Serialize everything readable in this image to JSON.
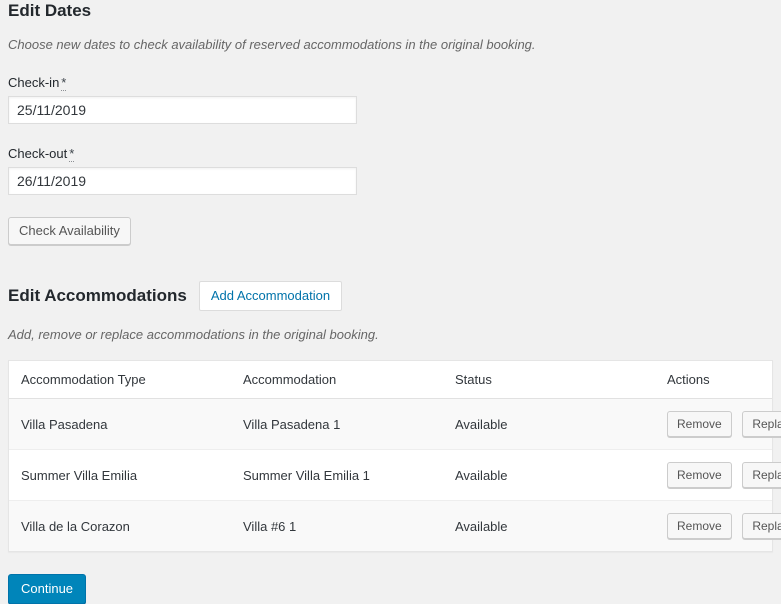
{
  "dates_section": {
    "title": "Edit Dates",
    "description": "Choose new dates to check availability of reserved accommodations in the original booking.",
    "checkin": {
      "label": "Check-in",
      "required_mark": "*",
      "value": "25/11/2019",
      "placeholder": ""
    },
    "checkout": {
      "label": "Check-out",
      "required_mark": "*",
      "value": "26/11/2019",
      "placeholder": ""
    },
    "check_availability_label": "Check Availability"
  },
  "accommodations_section": {
    "title": "Edit Accommodations",
    "add_button_label": "Add Accommodation",
    "description": "Add, remove or replace accommodations in the original booking.",
    "table": {
      "columns": [
        "Accommodation Type",
        "Accommodation",
        "Status",
        "Actions"
      ],
      "rows": [
        {
          "type": "Villa Pasadena",
          "accommodation": "Villa Pasadena 1",
          "status": "Available",
          "remove_label": "Remove",
          "replace_label": "Replace"
        },
        {
          "type": "Summer Villa Emilia",
          "accommodation": "Summer Villa Emilia 1",
          "status": "Available",
          "remove_label": "Remove",
          "replace_label": "Replace"
        },
        {
          "type": "Villa de la Corazon",
          "accommodation": "Villa #6 1",
          "status": "Available",
          "remove_label": "Remove",
          "replace_label": "Replace"
        }
      ]
    }
  },
  "footer": {
    "continue_label": "Continue"
  },
  "colors": {
    "page_background": "#f1f1f1",
    "primary_button": "#0085ba",
    "link_blue": "#0073aa",
    "status_green": "#008000",
    "heading": "#23282d",
    "muted_text": "#666666"
  }
}
